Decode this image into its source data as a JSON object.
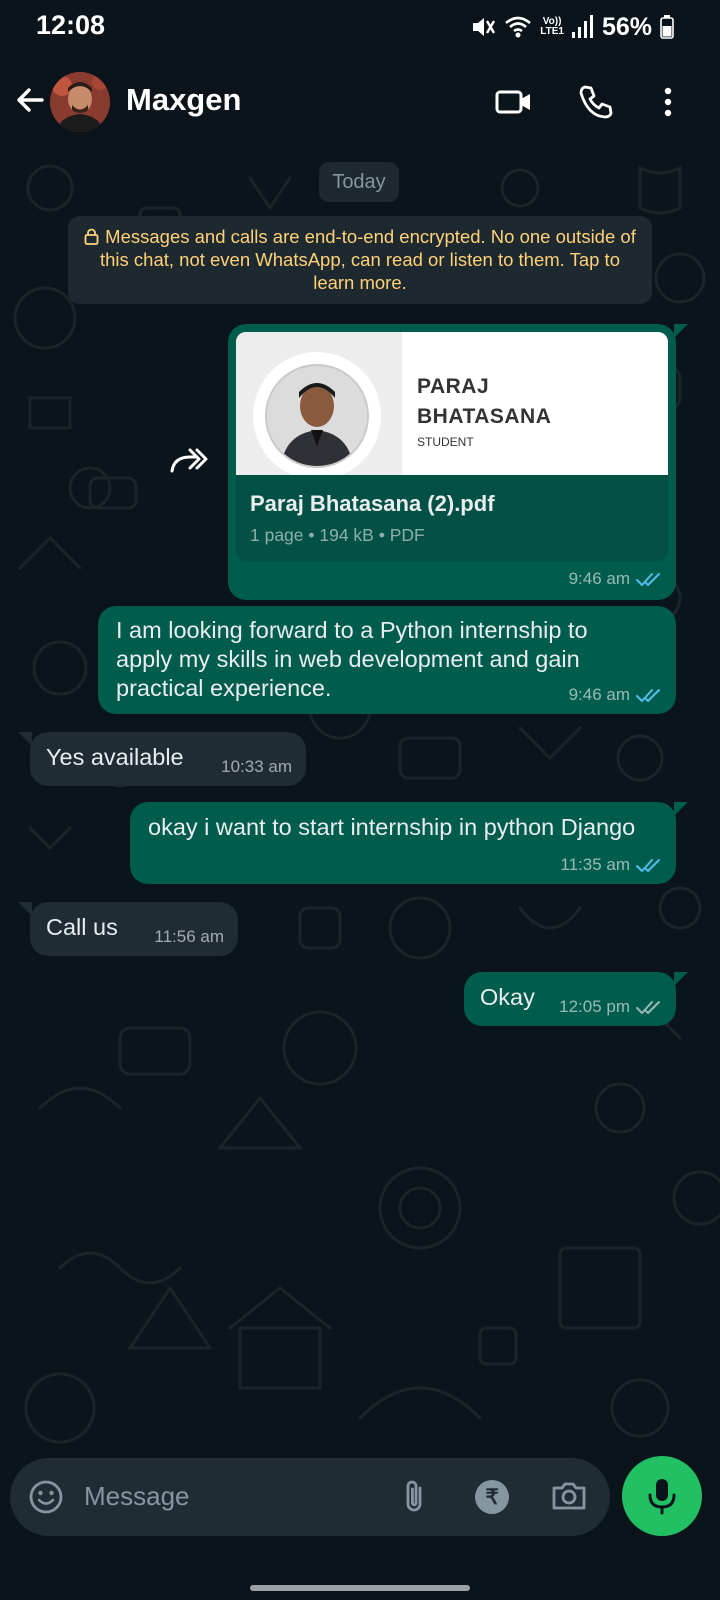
{
  "status_bar": {
    "time": "12:08",
    "network_label_top": "Vo))",
    "network_label_bottom": "LTE1",
    "battery": "56%"
  },
  "header": {
    "contact_name": "Maxgen"
  },
  "chat": {
    "date_label": "Today",
    "encryption_notice": "Messages and calls are end-to-end encrypted. No one outside of this chat, not even WhatsApp, can read or listen to them. Tap to learn more.",
    "document": {
      "preview_name_line1": "PARAJ",
      "preview_name_line2": "BHATASANA",
      "preview_role": "STUDENT",
      "file_name": "Paraj Bhatasana (2).pdf",
      "file_meta": "1 page • 194 kB • PDF",
      "time": "9:46 am",
      "status": "read"
    },
    "messages": [
      {
        "direction": "out",
        "text": "I am looking forward to a Python internship to apply my skills in web development and gain practical experience.",
        "time": "9:46 am",
        "status": "read"
      },
      {
        "direction": "in",
        "text": "Yes available",
        "time": "10:33 am"
      },
      {
        "direction": "out",
        "text": "okay i want to start internship in python Django",
        "time": "11:35 am",
        "status": "read"
      },
      {
        "direction": "in",
        "text": "Call us",
        "time": "11:56 am"
      },
      {
        "direction": "out",
        "text": "Okay",
        "time": "12:05 pm",
        "status": "delivered"
      }
    ]
  },
  "input": {
    "placeholder": "Message",
    "currency_symbol": "₹"
  },
  "icons": {
    "back": "arrow-left-icon",
    "video": "video-camera-icon",
    "call": "phone-icon",
    "menu": "more-vert-icon",
    "forward": "forward-icon",
    "emoji": "emoji-icon",
    "attach": "paperclip-icon",
    "payment": "rupee-icon",
    "camera": "camera-icon",
    "mic": "microphone-icon"
  },
  "colors": {
    "background": "#0b141a",
    "outgoing_bubble": "#005c4b",
    "incoming_bubble": "#1f2c34",
    "encryption_text": "#ffd279",
    "read_ticks": "#53bdeb",
    "mic_button": "#21c063"
  }
}
